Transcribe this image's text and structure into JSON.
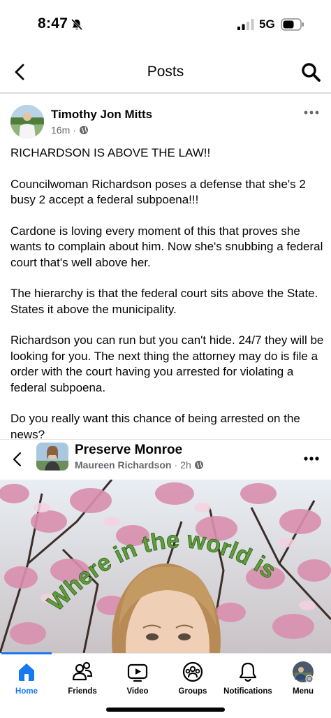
{
  "status_bar": {
    "time": "8:47",
    "network": "5G"
  },
  "header": {
    "title": "Posts"
  },
  "post": {
    "author": "Timothy Jon Mitts",
    "time": "16m",
    "separator": "·",
    "paragraphs": [
      "RICHARDSON IS ABOVE THE LAW!!",
      "Councilwoman Richardson poses a defense that she's 2 busy 2 accept a federal subpoena!!!",
      "Cardone is loving every moment of this that proves she wants to complain about him. Now she's snubbing a federal court that's well above her.",
      "The hierarchy is that the federal court sits above the State. States it above the municipality.",
      "Richardson you can run but you can't hide. 24/7 they will be looking for you. The next thing the attorney may do is file a order with the court having you arrested for violating a federal subpoena.",
      "Do you really want this chance of being arrested on the news?"
    ]
  },
  "shared": {
    "group": "Preserve Monroe",
    "author": "Maureen Richardson",
    "time": "2h",
    "separator": "·",
    "image_caption": "Where in the world is"
  },
  "tabs": [
    {
      "label": "Home",
      "icon": "home-icon",
      "active": true
    },
    {
      "label": "Friends",
      "icon": "friends-icon"
    },
    {
      "label": "Video",
      "icon": "video-icon"
    },
    {
      "label": "Groups",
      "icon": "groups-icon"
    },
    {
      "label": "Notifications",
      "icon": "bell-icon"
    },
    {
      "label": "Menu",
      "icon": "profile-menu-icon"
    }
  ],
  "colors": {
    "accent": "#1877f2",
    "caption_text": "#5f9f3a",
    "blossom": "#d98fae"
  }
}
